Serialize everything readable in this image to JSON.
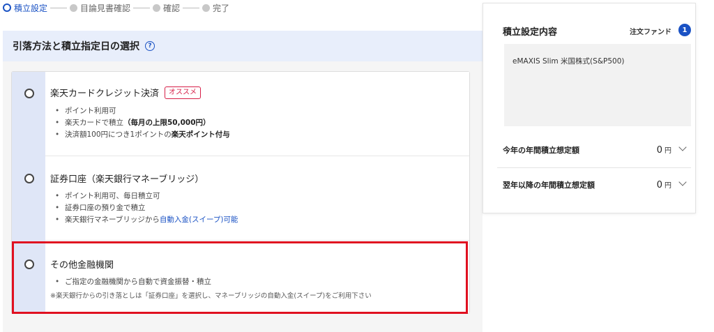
{
  "stepper": {
    "steps": [
      {
        "label": "積立設定",
        "active": true
      },
      {
        "label": "目論見書確認",
        "active": false
      },
      {
        "label": "確認",
        "active": false
      },
      {
        "label": "完了",
        "active": false
      }
    ]
  },
  "section": {
    "title": "引落方法と積立指定日の選択",
    "help_icon": "question-circle-icon"
  },
  "options": [
    {
      "title": "楽天カードクレジット決済",
      "badge": "オススメ",
      "bullets": [
        {
          "text": "ポイント利用可"
        },
        {
          "text": "楽天カードで積立",
          "bold": "（毎月の上限50,000円）"
        },
        {
          "text": "決済額100円につき1ポイントの",
          "bold": "楽天ポイント付与"
        }
      ]
    },
    {
      "title": "証券口座（楽天銀行マネーブリッジ）",
      "bullets": [
        {
          "text": "ポイント利用可、毎日積立可"
        },
        {
          "text": "証券口座の預り金で積立"
        },
        {
          "text": "楽天銀行マネーブリッジから",
          "link": "自動入金(スイープ)可能"
        }
      ]
    },
    {
      "title": "その他金融機関",
      "bullets": [
        {
          "text": "ご指定の金融機関から自動で資金振替・積立"
        }
      ],
      "note": "※楽天銀行からの引き落としは「証券口座」を選択し、マネーブリッジの自動入金(スイープ)をご利用下さい"
    }
  ],
  "summary": {
    "title": "積立設定内容",
    "fund_label": "注文ファンド",
    "fund_count": "1",
    "fund_name": "eMAXIS Slim 米国株式(S&P500)",
    "this_year": {
      "label": "今年の年間積立想定額",
      "value": "0",
      "unit": "円"
    },
    "next_years": {
      "label": "翌年以降の年間積立想定額",
      "value": "0",
      "unit": "円"
    }
  },
  "colors": {
    "accent": "#1a52c4",
    "badge": "#d61d46",
    "highlight": "#e01020"
  }
}
